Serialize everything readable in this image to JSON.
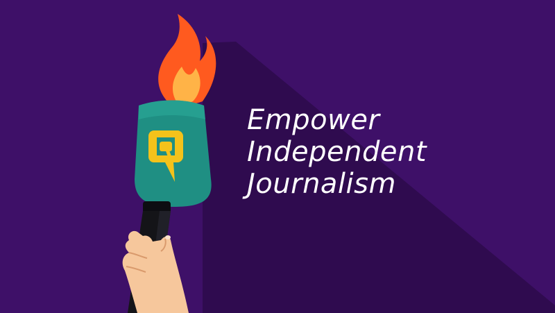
{
  "headline": {
    "line1": "Empower",
    "line2": "Independent",
    "line3": "Journalism"
  },
  "colors": {
    "background": "#3e1068",
    "shadow": "#2f0b4f",
    "mic_head": "#1f8f83",
    "logo": "#f4c21b",
    "flame_outer": "#ff5a1f",
    "flame_inner": "#ffb347",
    "handle": "#141418",
    "hand": "#f6c79c",
    "text": "#ffffff"
  },
  "icons": [
    "flame-icon",
    "microphone-icon",
    "quint-logo-icon",
    "hand-icon"
  ]
}
